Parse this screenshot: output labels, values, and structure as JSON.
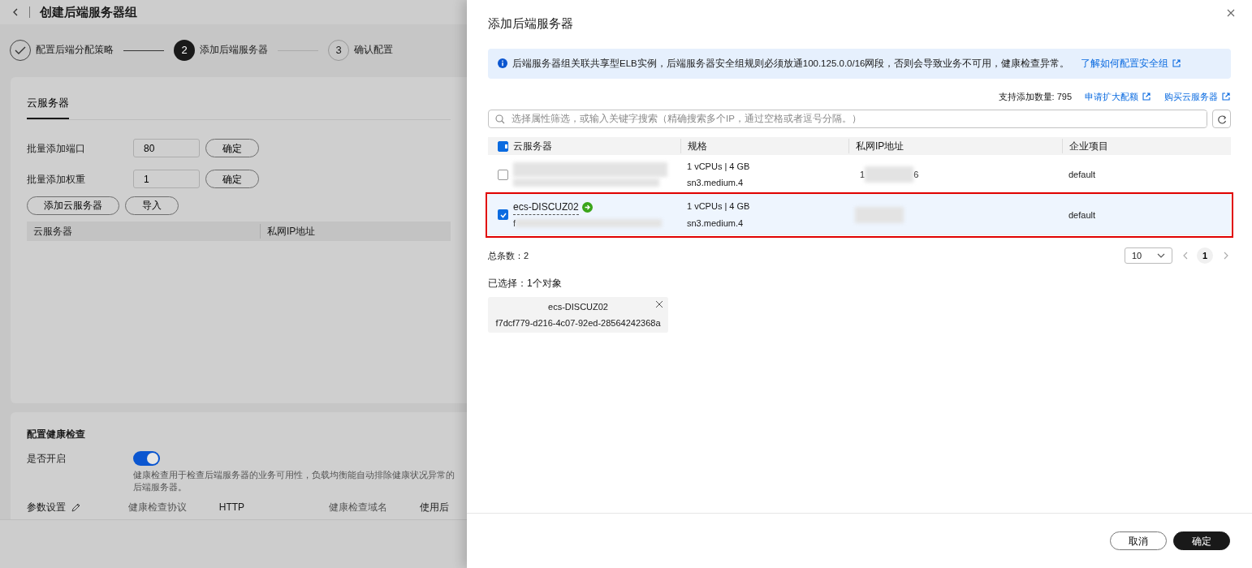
{
  "page": {
    "title": "创建后端服务器组",
    "steps": [
      {
        "label": "配置后端分配策略",
        "done": true,
        "selected": false
      },
      {
        "label": "添加后端服务器",
        "number": "2",
        "done": false,
        "selected": true
      },
      {
        "label": "确认配置",
        "number": "3",
        "done": false,
        "selected": false
      }
    ],
    "tabs": [
      {
        "label": "云服务器",
        "selected": true
      }
    ],
    "batch": [
      {
        "label": "批量添加端口",
        "value": "80",
        "button": "确定"
      },
      {
        "label": "批量添加权重",
        "value": "1",
        "button": "确定"
      }
    ],
    "actions": [
      "添加云服务器",
      "导入"
    ],
    "columns": [
      "云服务器",
      "私网IP地址"
    ],
    "health": {
      "title": "配置健康检查",
      "enable_label": "是否开启",
      "on": true,
      "hint": "健康检查用于检查后端服务器的业务可用性，负载均衡能自动排除健康状况异常的后端服务器。",
      "params_label": "参数设置",
      "fields": [
        {
          "label": "健康检查协议",
          "value": "HTTP"
        },
        {
          "label": "健康检查域名",
          "value": "使用后"
        }
      ]
    }
  },
  "drawer": {
    "title": "添加后端服务器",
    "alert": {
      "text": "后端服务器组关联共享型ELB实例，后端服务器安全组规则必须放通100.125.0.0/16网段，否则会导致业务不可用，健康检查异常。",
      "link": "了解如何配置安全组"
    },
    "quota": "支持添加数量: 795",
    "links": [
      "申请扩大配额",
      "购买云服务器"
    ],
    "search": {
      "placeholder": "选择属性筛选，或输入关键字搜索（精确搜索多个IP，通过空格或者逗号分隔。）"
    },
    "header_check": {
      "indeterminate": true
    },
    "columns": [
      "云服务器",
      "规格",
      "私网IP地址",
      "企业项目"
    ],
    "rows": [
      {
        "selected": false,
        "highlighted": false,
        "spec": "1 vCPUs | 4 GB",
        "flavor": "sn3.medium.4",
        "ip_start": "1",
        "ip_end": "6",
        "project": "default"
      },
      {
        "selected": true,
        "highlighted": true,
        "name": "ecs-DISCUZ02",
        "id_start": "f",
        "spec": "1 vCPUs | 4 GB",
        "flavor": "sn3.medium.4",
        "project": "default"
      }
    ],
    "total": "总条数：2",
    "page_size": "10",
    "pages": [
      {
        "label": "1",
        "selected": true
      }
    ],
    "selected_label": "已选择：1个对象",
    "chips": [
      {
        "name": "ecs-DISCUZ02",
        "id": "f7dcf779-d216-4c07-92ed-28564242368a"
      }
    ],
    "buttons": [
      {
        "label": "取消",
        "kind": "secondary"
      },
      {
        "label": "确定",
        "kind": "primary"
      }
    ]
  }
}
